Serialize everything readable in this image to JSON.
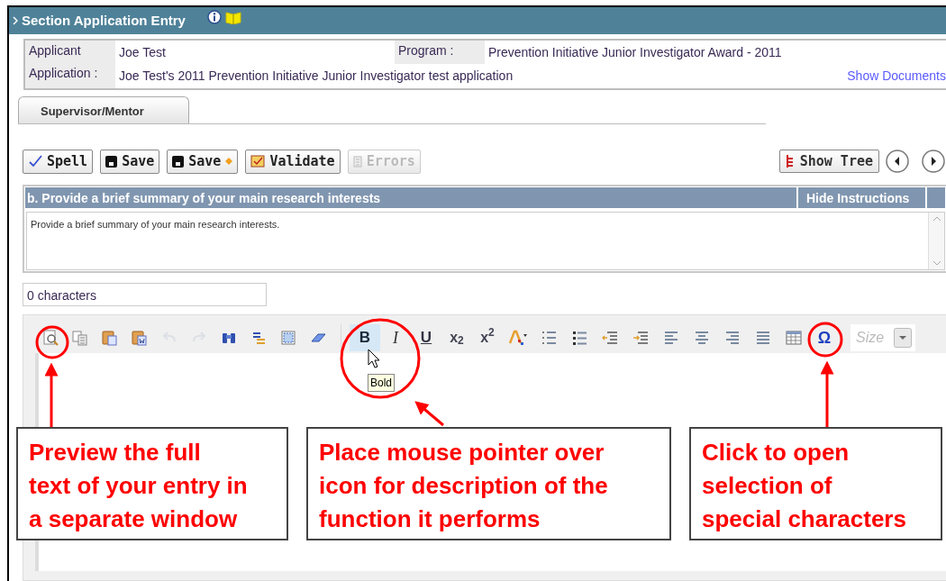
{
  "header": {
    "title": "Section Application Entry"
  },
  "applicant_info": {
    "applicant_label": "Applicant",
    "applicant": "Joe Test",
    "program_label": "Program :",
    "program": "Prevention Initiative Junior Investigator Award - 2011",
    "application_label": "Application :",
    "application": "Joe Test's 2011 Prevention Initiative Junior Investigator test application",
    "show_documents": "Show Documents"
  },
  "tabs": [
    {
      "label": "Supervisor/Mentor",
      "selected": true
    }
  ],
  "action_buttons": [
    {
      "label": "Spell",
      "kind": "spell",
      "disabled": false
    },
    {
      "label": "Save",
      "kind": "save",
      "disabled": false
    },
    {
      "label": "Save",
      "kind": "save_next",
      "disabled": false
    },
    {
      "label": "Validate",
      "kind": "validate",
      "disabled": false
    },
    {
      "label": "Errors",
      "kind": "errors",
      "disabled": true
    }
  ],
  "show_tree": {
    "label": "Show Tree"
  },
  "question": {
    "title": "b. Provide a brief summary of your main research interests",
    "hide_instructions": "Hide Instructions",
    "instructions": "Provide a brief summary of your main research interests."
  },
  "char_count": "0 characters",
  "editor_toolbar": {
    "groups": [
      [
        {
          "kind": "preview",
          "disabled": false,
          "hovered": false
        },
        {
          "kind": "copy",
          "disabled": false,
          "hovered": false
        },
        {
          "kind": "paste",
          "disabled": false,
          "hovered": false
        },
        {
          "kind": "paste_word",
          "disabled": false,
          "hovered": false
        },
        {
          "kind": "undo",
          "disabled": true,
          "hovered": false
        },
        {
          "kind": "redo",
          "disabled": true,
          "hovered": false
        },
        {
          "kind": "find",
          "disabled": false,
          "hovered": false
        },
        {
          "kind": "replace",
          "disabled": false,
          "hovered": false
        },
        {
          "kind": "select_all",
          "disabled": false,
          "hovered": false
        },
        {
          "kind": "eraser",
          "disabled": false,
          "hovered": false
        }
      ],
      [
        {
          "kind": "bold",
          "label": "B",
          "disabled": false,
          "hovered": true
        },
        {
          "kind": "italic",
          "label": "I",
          "disabled": false,
          "hovered": false
        },
        {
          "kind": "underline",
          "label": "U",
          "disabled": false,
          "hovered": false
        },
        {
          "kind": "subscript",
          "label": "x$_{2}$",
          "disabled": false,
          "hovered": false
        },
        {
          "kind": "superscript",
          "label": "x$^{2}$",
          "disabled": false,
          "hovered": false
        },
        {
          "kind": "text_color",
          "disabled": false,
          "hovered": false
        },
        {
          "kind": "numbered_list",
          "disabled": false,
          "hovered": false
        },
        {
          "kind": "bullet_list",
          "disabled": false,
          "hovered": false
        },
        {
          "kind": "outdent",
          "disabled": false,
          "hovered": false
        },
        {
          "kind": "indent",
          "disabled": false,
          "hovered": false
        },
        {
          "kind": "align_left",
          "disabled": false,
          "hovered": false
        },
        {
          "kind": "align_center",
          "disabled": false,
          "hovered": false
        },
        {
          "kind": "align_right",
          "disabled": false,
          "hovered": false
        },
        {
          "kind": "justify",
          "disabled": false,
          "hovered": false
        },
        {
          "kind": "table",
          "disabled": false,
          "hovered": false
        },
        {
          "kind": "special_character",
          "label": "Ω",
          "disabled": false,
          "hovered": false
        }
      ]
    ],
    "size_placeholder": "Size",
    "tooltip": "Bold"
  },
  "callouts": [
    {
      "text": "Preview the full\ntext of your entry in\na separate window"
    },
    {
      "text": "Place mouse pointer over\nicon for description of the\nfunction it performs"
    },
    {
      "text": "Click to open\nselection of\nspecial characters"
    }
  ]
}
